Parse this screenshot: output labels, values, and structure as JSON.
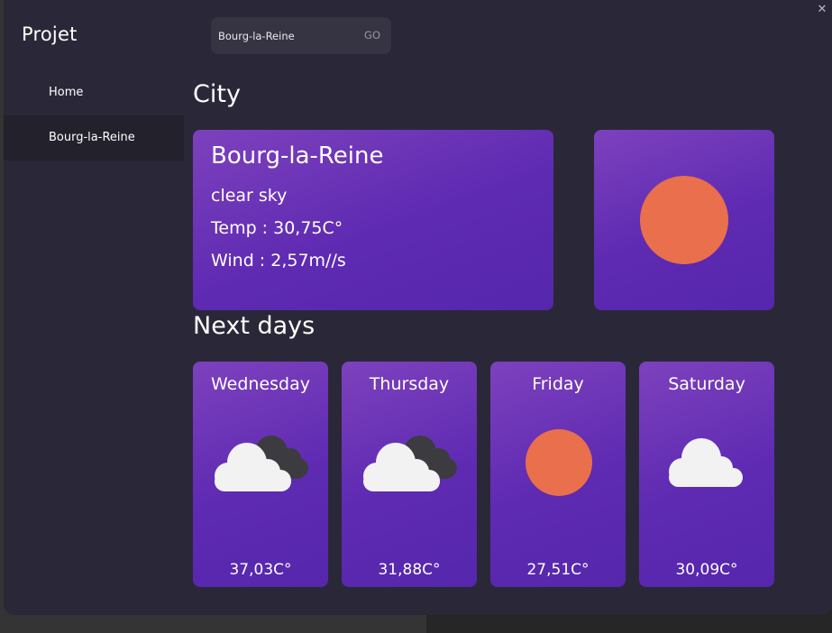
{
  "app": {
    "title": "Projet",
    "close_glyph": "✕"
  },
  "search": {
    "value": "Bourg-la-Reine",
    "go_label": "GO"
  },
  "sidebar": {
    "items": [
      {
        "label": "Home",
        "selected": false
      },
      {
        "label": "Bourg-la-Reine",
        "selected": true
      }
    ]
  },
  "city_section": {
    "title": "City",
    "city": "Bourg-la-Reine",
    "description": "clear sky",
    "temp": "Temp : 30,75C°",
    "wind": "Wind : 2,57m//s",
    "icon": "sun-icon"
  },
  "forecast_section": {
    "title": "Next days",
    "days": [
      {
        "day": "Wednesday",
        "temp": "37,03C°",
        "icon": "cloud-dark-cloud-icon"
      },
      {
        "day": "Thursday",
        "temp": "31,88C°",
        "icon": "cloud-dark-cloud-icon"
      },
      {
        "day": "Friday",
        "temp": "27,51C°",
        "icon": "sun-icon"
      },
      {
        "day": "Saturday",
        "temp": "30,09C°",
        "icon": "cloud-icon"
      }
    ]
  },
  "colors": {
    "window_bg": "#2a2838",
    "card_gradient_start": "#7d41bd",
    "card_gradient_end": "#5527ac",
    "sun": "#ea6f4c",
    "cloud": "#f2f2f2",
    "dark_cloud": "#3c3c40"
  }
}
